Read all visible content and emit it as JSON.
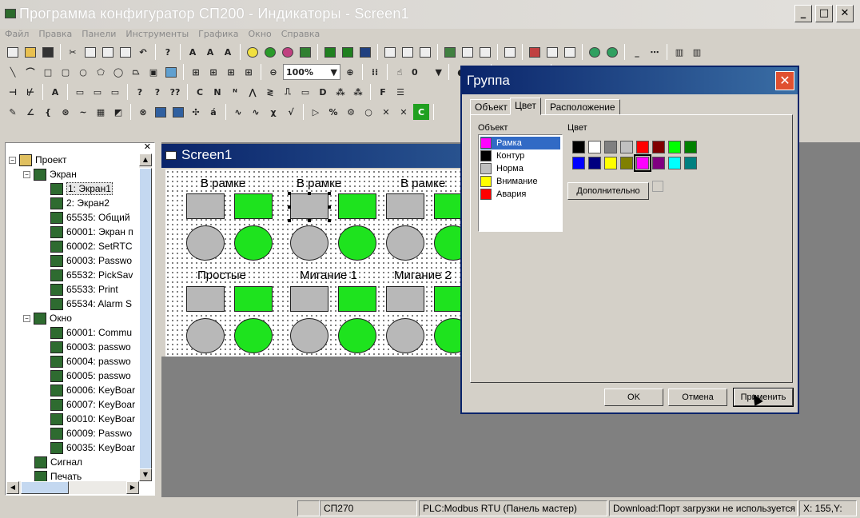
{
  "app": {
    "title": "Программа конфигуратор СП200 - Индикаторы - Screen1"
  },
  "menu": [
    "Файл",
    "Правка",
    "Панели",
    "Инструменты",
    "Графика",
    "Окно",
    "Справка"
  ],
  "toolbar": {
    "zoom": "100%",
    "layer": "0"
  },
  "tree": {
    "root": "Проект",
    "groups": [
      {
        "label": "Экран",
        "items": [
          "1: Экран1",
          "2: Экран2",
          "65535: Общий",
          "60001: Экран п",
          "60002: SetRTC",
          "60003: Passwo",
          "65532: PickSav",
          "65533: Print",
          "65534: Alarm S"
        ]
      },
      {
        "label": "Окно",
        "items": [
          "60001: Commu",
          "60003: passwo",
          "60004: passwo",
          "60005: passwo",
          "60006: KeyBoar",
          "60007: KeyBoar",
          "60010: KeyBoar",
          "60009: Passwo",
          "60035: KeyBoar"
        ]
      }
    ],
    "tail": [
      "Сигнал",
      "Печать"
    ]
  },
  "screen": {
    "title": "Screen1",
    "labels_top": [
      "В рамке",
      "В рамке",
      "В рамке"
    ],
    "labels_bottom": [
      "Простые",
      "Мигание 1",
      "Мигание 2"
    ]
  },
  "dialog": {
    "title": "Группа",
    "tabs": [
      "Объект",
      "Цвет",
      "Расположение"
    ],
    "active_tab": "Цвет",
    "object_label": "Объект",
    "color_label": "Цвет",
    "objects": [
      {
        "label": "Рамка",
        "color": "#ff00ff"
      },
      {
        "label": "Контур",
        "color": "#000000"
      },
      {
        "label": "Норма",
        "color": "#c0c0c0"
      },
      {
        "label": "Внимание",
        "color": "#ffff00"
      },
      {
        "label": "Авария",
        "color": "#ff0000"
      }
    ],
    "palette": [
      "#000000",
      "#ffffff",
      "#808080",
      "#c0c0c0",
      "#ff0000",
      "#800000",
      "#00ff00",
      "#008000",
      "#0000ff",
      "#000080",
      "#ffff00",
      "#808000",
      "#ff00ff",
      "#800080",
      "#00ffff",
      "#008080"
    ],
    "more_button": "Дополнительно",
    "ok": "OK",
    "cancel": "Отмена",
    "apply": "Применить"
  },
  "status": {
    "model": "СП270",
    "plc": "PLC:Modbus RTU (Панель мастер)",
    "download": "Download:Порт загрузки не используется",
    "coords": "X: 155,Y:"
  }
}
